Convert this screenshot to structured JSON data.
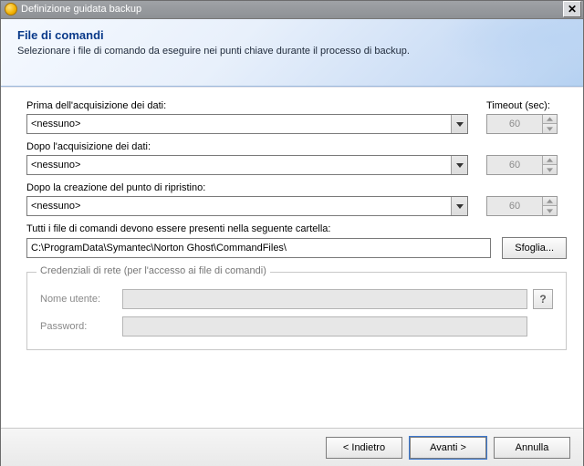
{
  "window": {
    "title": "Definizione guidata backup"
  },
  "header": {
    "title": "File di comandi",
    "subtitle": "Selezionare i file di comando da eseguire nei punti chiave durante il processo di backup."
  },
  "labels": {
    "before": "Prima dell'acquisizione dei dati:",
    "after": "Dopo l'acquisizione dei dati:",
    "afterRestore": "Dopo la creazione del punto di ripristino:",
    "timeout": "Timeout (sec):",
    "folderNote": "Tutti i file di comandi devono essere presenti nella seguente cartella:"
  },
  "combos": {
    "before": "<nessuno>",
    "after": "<nessuno>",
    "afterRestore": "<nessuno>"
  },
  "timeouts": {
    "before": "60",
    "after": "60",
    "afterRestore": "60"
  },
  "folder": {
    "path": "C:\\ProgramData\\Symantec\\Norton Ghost\\CommandFiles\\",
    "browse": "Sfoglia..."
  },
  "credentials": {
    "legend": "Credenziali di rete (per l'accesso ai file di comandi)",
    "usernameLabel": "Nome utente:",
    "passwordLabel": "Password:",
    "username": "",
    "password": ""
  },
  "buttons": {
    "back": "< Indietro",
    "next": "Avanti >",
    "cancel": "Annulla"
  }
}
